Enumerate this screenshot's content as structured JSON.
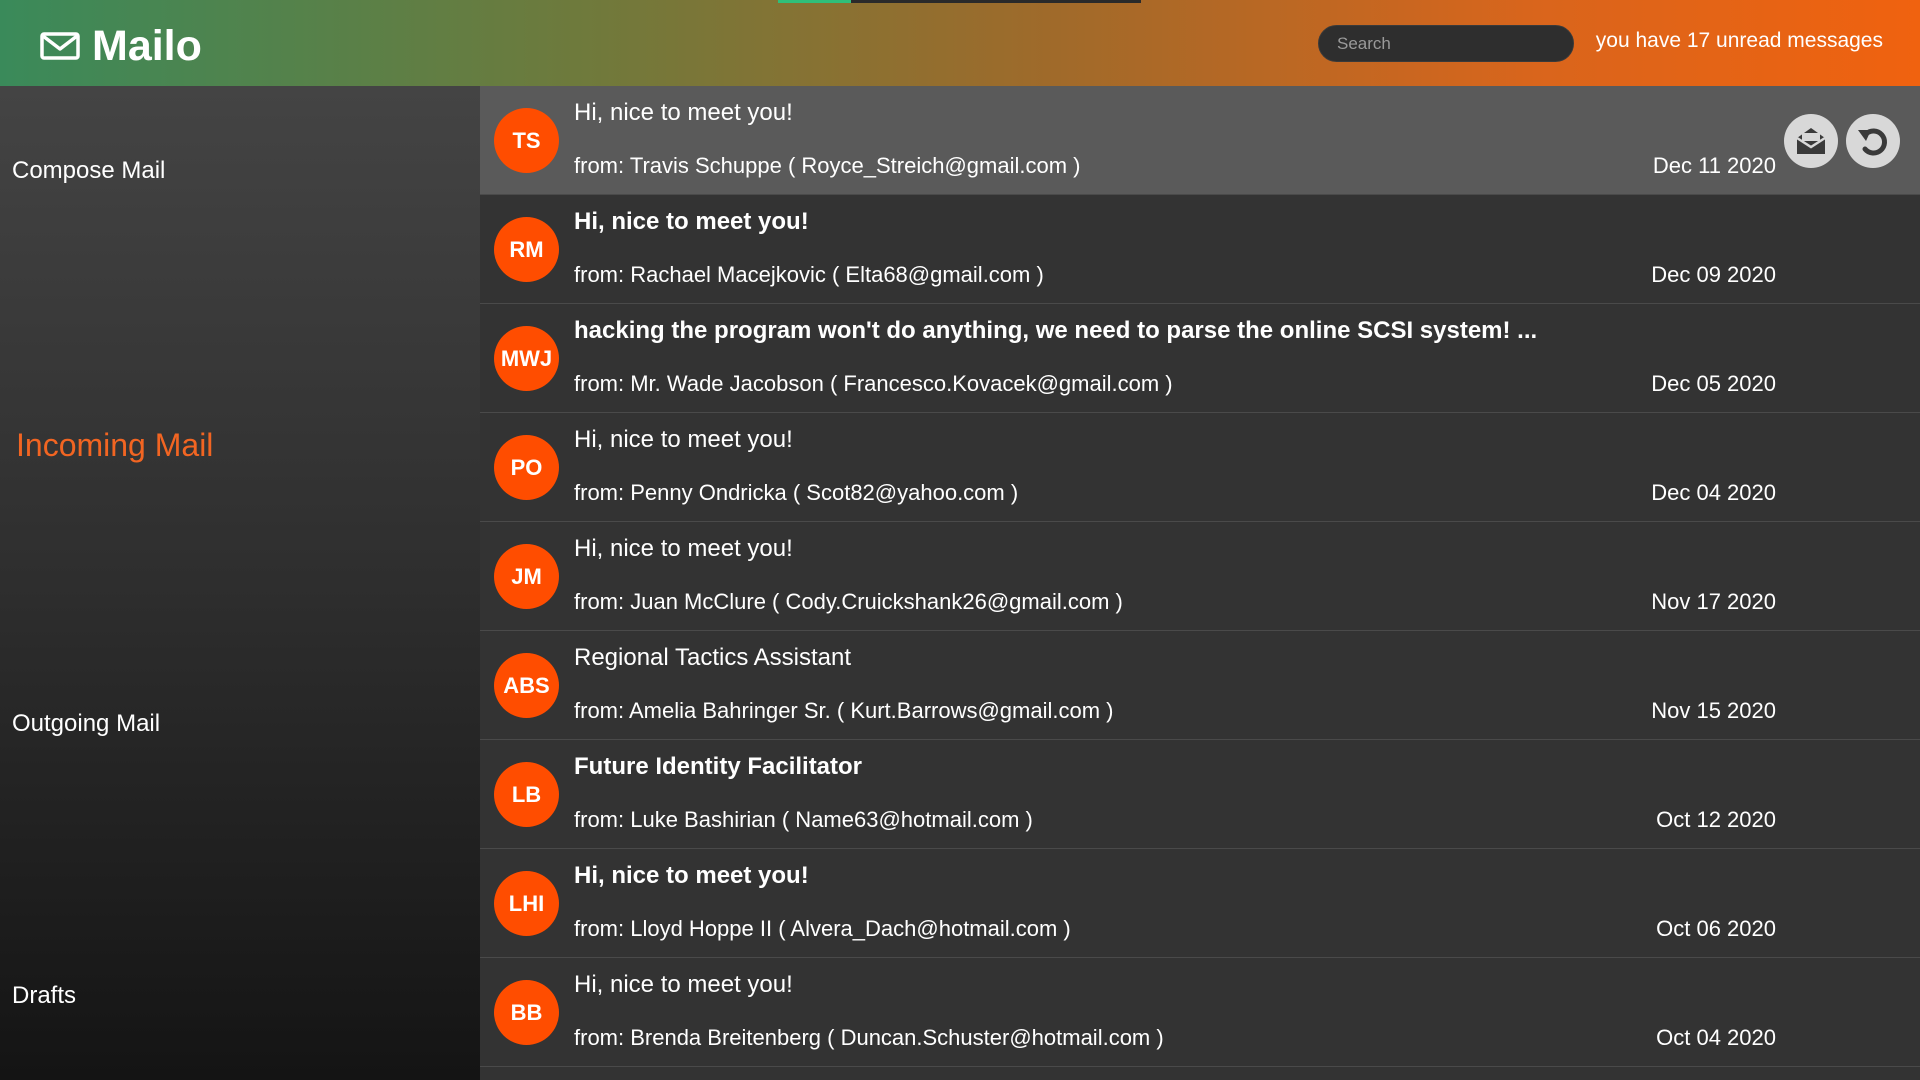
{
  "header": {
    "app_name": "Mailo",
    "logo_icon": "mail-icon",
    "search_placeholder": "Search",
    "unread_text": "you have 17 unread messages",
    "loading_progress": 0.2,
    "colors": {
      "gradient_start": "#3a8a5a",
      "gradient_end": "#f0620f"
    }
  },
  "sidebar": {
    "items": [
      {
        "label": "Compose Mail"
      },
      {
        "label": "Incoming Mail"
      },
      {
        "label": "Outgoing Mail"
      },
      {
        "label": "Drafts"
      }
    ],
    "active_index": 1,
    "active_color": "#f26522"
  },
  "mail": {
    "avatar_color": "#ff4d00",
    "selected_index": 0,
    "selected_actions": [
      "mark-read-icon",
      "reply-icon"
    ],
    "rows": [
      {
        "initials": "TS",
        "subject": "Hi, nice to meet you!",
        "from": "from: Travis Schuppe ( Royce_Streich@gmail.com )",
        "date": "Dec 11 2020",
        "unread": false
      },
      {
        "initials": "RM",
        "subject": "Hi, nice to meet you!",
        "from": "from: Rachael Macejkovic ( Elta68@gmail.com )",
        "date": "Dec 09 2020",
        "unread": true
      },
      {
        "initials": "MWJ",
        "subject": "hacking the program won't do anything, we need to parse the online SCSI system! ...",
        "from": "from: Mr. Wade Jacobson ( Francesco.Kovacek@gmail.com )",
        "date": "Dec 05 2020",
        "unread": true
      },
      {
        "initials": "PO",
        "subject": "Hi, nice to meet you!",
        "from": "from: Penny Ondricka ( Scot82@yahoo.com )",
        "date": "Dec 04 2020",
        "unread": false
      },
      {
        "initials": "JM",
        "subject": "Hi, nice to meet you!",
        "from": "from: Juan McClure ( Cody.Cruickshank26@gmail.com )",
        "date": "Nov 17 2020",
        "unread": false
      },
      {
        "initials": "ABS",
        "subject": "Regional Tactics Assistant",
        "from": "from: Amelia Bahringer Sr. ( Kurt.Barrows@gmail.com )",
        "date": "Nov 15 2020",
        "unread": false
      },
      {
        "initials": "LB",
        "subject": "Future Identity Facilitator",
        "from": "from: Luke Bashirian ( Name63@hotmail.com )",
        "date": "Oct 12 2020",
        "unread": true
      },
      {
        "initials": "LHI",
        "subject": "Hi, nice to meet you!",
        "from": "from: Lloyd Hoppe II ( Alvera_Dach@hotmail.com )",
        "date": "Oct 06 2020",
        "unread": true
      },
      {
        "initials": "BB",
        "subject": "Hi, nice to meet you!",
        "from": "from: Brenda Breitenberg ( Duncan.Schuster@hotmail.com )",
        "date": "Oct 04 2020",
        "unread": false
      }
    ]
  }
}
